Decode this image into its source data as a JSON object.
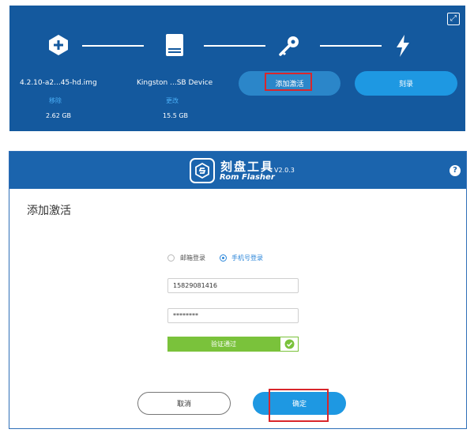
{
  "flasher": {
    "image": {
      "name": "4.2.10-a2...45-hd.img",
      "action": "移除",
      "size": "2.62 GB"
    },
    "device": {
      "name": "Kingston ...SB Device",
      "action": "更改",
      "size": "15.5 GB"
    },
    "activate_label": "添加激活",
    "flash_label": "刻录"
  },
  "dialog": {
    "brand_cn": "刻盘工具",
    "brand_en": "Rom Flasher",
    "version": "V2.0.3",
    "help": "?",
    "title": "添加激活",
    "login_options": [
      {
        "label": "邮箱登录",
        "selected": false
      },
      {
        "label": "手机号登录",
        "selected": true
      }
    ],
    "phone": {
      "value": "15829081416"
    },
    "password": {
      "value": "********"
    },
    "verify_label": "验证通过",
    "cancel_label": "取消",
    "confirm_label": "确定"
  },
  "colors": {
    "panel_bg": "#14599e",
    "accent": "#1e98e2",
    "success": "#7ac23b",
    "highlight": "#d9262b"
  }
}
